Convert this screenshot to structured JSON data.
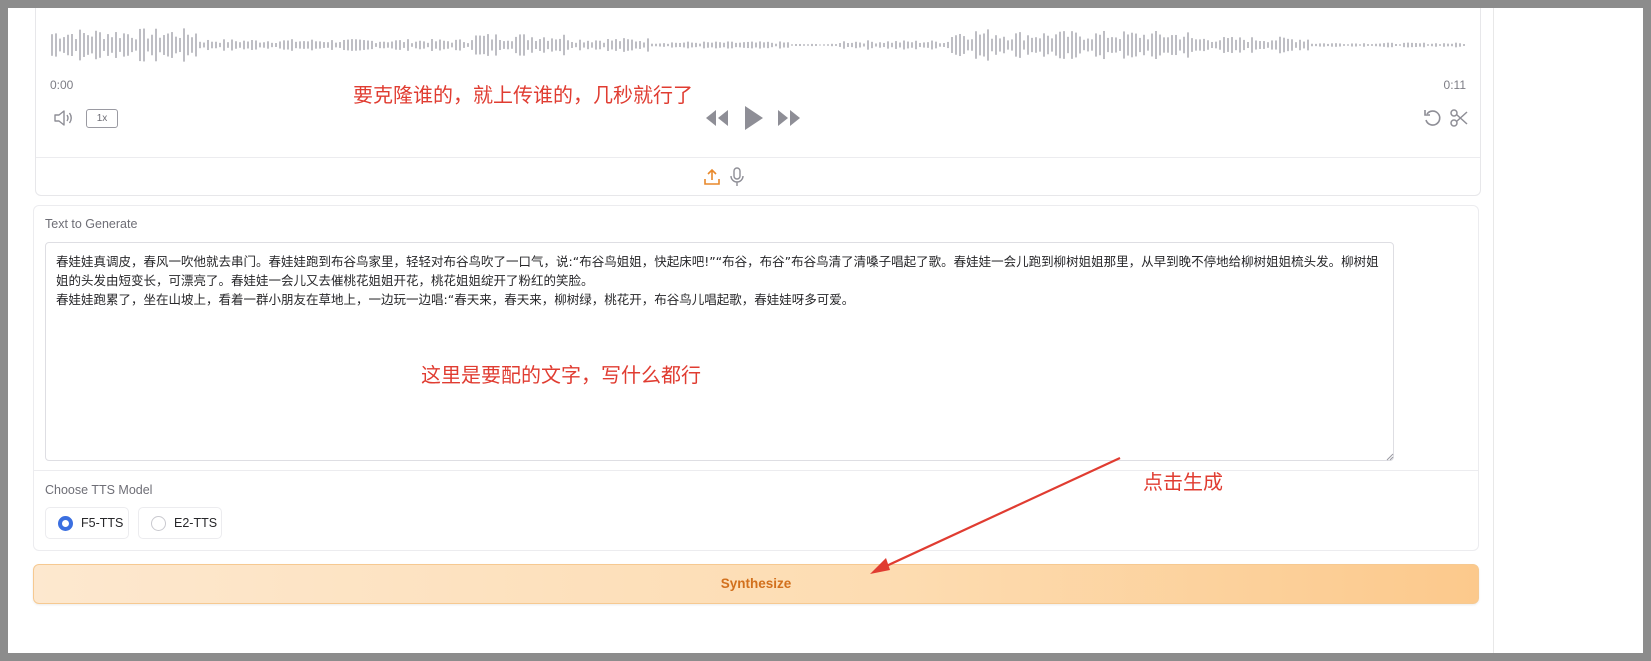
{
  "audio": {
    "time_start": "0:00",
    "time_end": "0:11",
    "speed_label": "1x",
    "icons": [
      "volume-icon",
      "rewind-icon",
      "play-icon",
      "forward-icon",
      "undo-icon",
      "scissors-icon",
      "upload-icon",
      "microphone-icon"
    ]
  },
  "annotations": {
    "clone_hint": "要克隆谁的，就上传谁的，几秒就行了",
    "text_hint": "这里是要配的文字，写什么都行",
    "click_hint": "点击生成"
  },
  "text_section": {
    "label": "Text to Generate",
    "value": "春娃娃真调皮，春风一吹他就去串门。春娃娃跑到布谷鸟家里，轻轻对布谷鸟吹了一口气，说:“布谷鸟姐姐，快起床吧!”“布谷，布谷”布谷鸟清了清嗓子唱起了歌。春娃娃一会儿跑到柳树姐姐那里，从早到晚不停地给柳树姐姐梳头发。柳树姐姐的头发由短变长，可漂亮了。春娃娃一会儿又去催桃花姐姐开花，桃花姐姐绽开了粉红的笑脸。\n春娃娃跑累了，坐在山坡上，看着一群小朋友在草地上，一边玩一边唱:“春天来，春天来，柳树绿，桃花开，布谷鸟儿唱起歌，春娃娃呀多可爱。"
  },
  "model_section": {
    "label": "Choose TTS Model",
    "options": [
      {
        "label": "F5-TTS",
        "selected": true
      },
      {
        "label": "E2-TTS",
        "selected": false
      }
    ]
  },
  "synthesize": {
    "label": "Synthesize"
  },
  "colors": {
    "accent": "#3b6fe0",
    "annotation": "#e03c31",
    "button_text": "#d2701d",
    "upload_icon": "#e8892c"
  }
}
